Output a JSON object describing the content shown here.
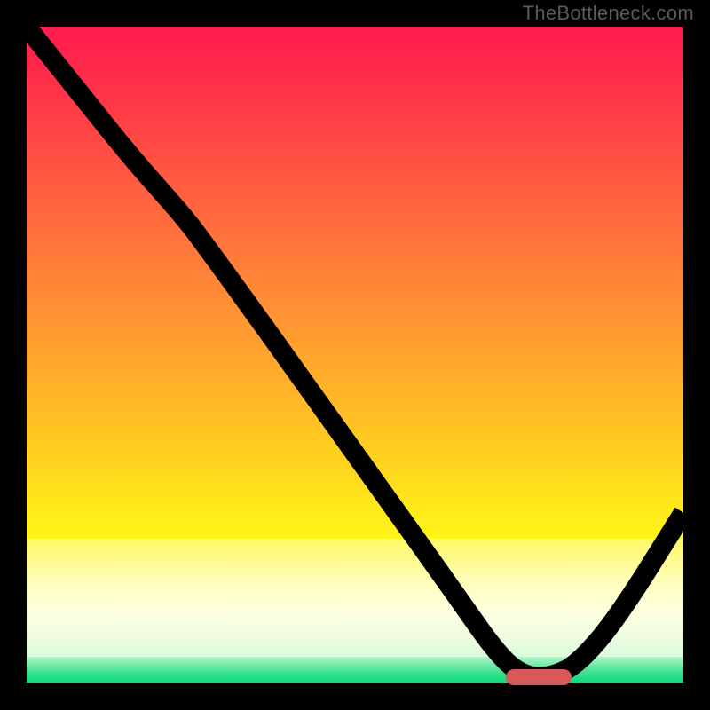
{
  "attribution": "TheBottleneck.com",
  "colors": {
    "top": "#ff1d4e",
    "mid": "#ffd21e",
    "bottom_green": "#13d67f",
    "marker": "#d75a5a",
    "curve": "#000000"
  },
  "chart_data": {
    "type": "line",
    "title": "",
    "xlabel": "",
    "ylabel": "",
    "xlim": [
      0,
      100
    ],
    "ylim": [
      0,
      100
    ],
    "grid": false,
    "legend": false,
    "background": "rainbow-gradient",
    "series": [
      {
        "name": "bottleneck-curve",
        "x": [
          0,
          8,
          16,
          24,
          27,
          35,
          45,
          55,
          65,
          72,
          76,
          80,
          84,
          90,
          100
        ],
        "y": [
          100,
          90,
          80,
          71,
          67,
          56,
          42,
          28,
          14,
          4,
          1,
          1,
          3,
          10,
          26
        ]
      }
    ],
    "markers": [
      {
        "name": "optimal-range",
        "x_center": 78,
        "y": 1,
        "width_pct": 10
      }
    ]
  }
}
